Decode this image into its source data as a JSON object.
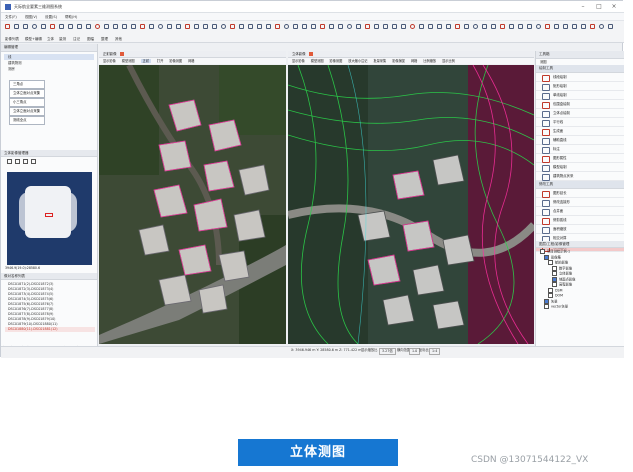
{
  "app": {
    "title": "天际航全要素三维测图系统",
    "menus": [
      "文件(F)",
      "视图(V)",
      "设置(S)",
      "帮助(H)"
    ],
    "ribbon_tabs": [
      "影像列表",
      "模型+编辑",
      "立体",
      "量测",
      "注记",
      "图幅",
      "整理",
      "其他"
    ]
  },
  "left_panel": {
    "header": "编辑管理",
    "items": [
      "线",
      "建筑物测",
      "测房"
    ],
    "layer_buttons": [
      "三角点",
      "立体立面对点采集",
      "小三角点",
      "立体立面对点采集",
      "测线全点"
    ],
    "overview_header": "立体影像管理器",
    "coord_readout": "3946.9(19.0):28580.6",
    "list_header": "像对名称列表",
    "list": [
      "DSC01871(2)-DSC01872(3)",
      "DSC01872(3)-DSC01873(4)",
      "DSC01873(4)-DSC01874(5)",
      "DSC01874(5)-DSC01875(6)",
      "DSC01875(6)-DSC01876(7)",
      "DSC01876(7)-DSC01877(8)",
      "DSC01877(8)-DSC01878(9)",
      "DSC01878(9)-DSC01879(10)",
      "DSC01879(10)-DSC01880(11)",
      "DSC01880(11)-DSC01881(12)"
    ],
    "list_selected_index": 9,
    "bottom_buttons": [
      "添加/打开像对列表(1)",
      "删除选中像对(2)"
    ]
  },
  "pane1": {
    "title": "正射影像",
    "tabs": [
      "显示影像",
      "模型测图",
      "正射",
      "打开",
      "影像测图",
      "网格"
    ],
    "active_tab": "正射"
  },
  "pane2": {
    "title": "立体影像",
    "tabs": [
      "显示影像",
      "模型测图",
      "影像测图",
      "放大缩小注记",
      "批量采集",
      "影像捕捉",
      "网格",
      "比例缩放",
      "显示比例"
    ]
  },
  "right_panel": {
    "header": "工具箱",
    "tab": "测图",
    "group1": "绘制工具",
    "tools": [
      "线段绘制",
      "矩形绘制",
      "单线绘制",
      "包围盒绘制",
      "立体点绘制",
      "平行线",
      "生成面",
      "辅助直线",
      "标注",
      "图形属性",
      "模型绘制",
      "建筑物点状采"
    ],
    "group2": "修改工具",
    "modify_tools": [
      "图形延长",
      "修改连接形",
      "合并面",
      "修剪弧线",
      "面积缩放",
      "相交对算",
      "测线工具"
    ],
    "selected_tool": "测线工具",
    "tree_header": "图层/工程/影像管理",
    "tree": [
      "项目测绘示例-1",
      "影像集",
      "航拍影像",
      "数字影像",
      "立体影像",
      "地面点影像",
      "高程影像",
      "DSM",
      "DOM",
      "矢量",
      "vector矢量"
    ]
  },
  "statusbar": {
    "coords": "X: 3946.946 m  Y: 28580.6 m  Z: 771.422 m",
    "zoom_label": "显示缩放比",
    "zoom_value": "3.27倍",
    "range_label": "横向范围",
    "range_value": "1.0",
    "ratio_label": "坐标比",
    "ratio_value": "1:4"
  },
  "caption": "立体测图",
  "watermark": "CSDN @13071544122_VX",
  "colors": {
    "accent": "#1677d2",
    "selected_tool": "#f3c9c9",
    "overview_bg": "#1f3a6b",
    "vector_green": "#2bd24a",
    "vector_magenta": "#ff2fa0"
  }
}
